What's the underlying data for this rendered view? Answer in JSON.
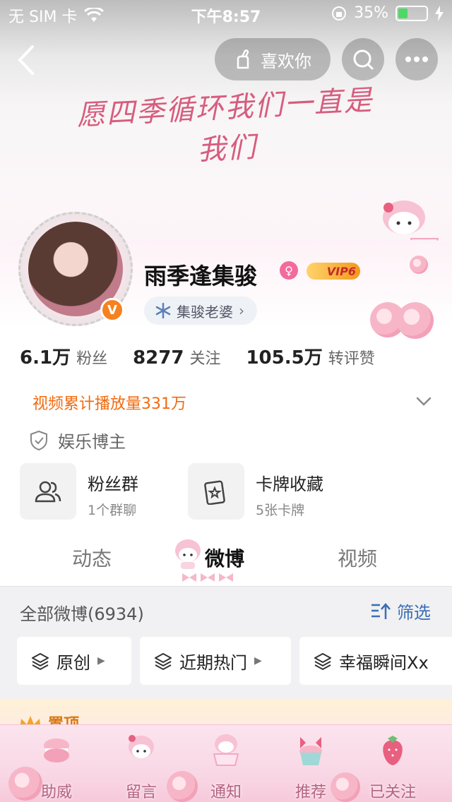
{
  "status_bar": {
    "carrier": "无 SIM 卡",
    "time": "下午8:57",
    "battery_percent": "35%",
    "battery_level": 0.35
  },
  "header": {
    "like_button_label": "喜欢你",
    "signature": "愿四季循环我们一直是我们"
  },
  "profile": {
    "name": "雨季逢集骏",
    "vip_label": "VIP6",
    "fan_group_tag": "集骏老婆",
    "stats": [
      {
        "value": "6.1万",
        "label": "粉丝"
      },
      {
        "value": "8277",
        "label": "关注"
      },
      {
        "value": "105.5万",
        "label": "转评赞"
      }
    ],
    "play_count": "视频累计播放量331万",
    "category": "娱乐博主",
    "tiles": [
      {
        "title": "粉丝群",
        "subtitle": "1个群聊"
      },
      {
        "title": "卡牌收藏",
        "subtitle": "5张卡牌"
      }
    ]
  },
  "tabs": [
    {
      "label": "动态",
      "active": false
    },
    {
      "label": "微博",
      "active": true
    },
    {
      "label": "视频",
      "active": false
    }
  ],
  "feed": {
    "count_label": "全部微博(6934)",
    "filter_label": "筛选",
    "chips": [
      "原创",
      "近期热门",
      "幸福瞬间Xx"
    ],
    "pinned_label": "置顶"
  },
  "bottom_bar": [
    {
      "label": "助威",
      "icon": "macaron-icon"
    },
    {
      "label": "留言",
      "icon": "bunny-icon"
    },
    {
      "label": "通知",
      "icon": "bunny-cup-icon"
    },
    {
      "label": "推荐",
      "icon": "cupcake-icon"
    },
    {
      "label": "已关注",
      "icon": "strawberry-icon"
    }
  ],
  "colors": {
    "accent_orange": "#f26a0e",
    "link_blue": "#3a6fb5",
    "vip_gold": "#f39a1c",
    "theme_pink": "#f9d8e6"
  }
}
